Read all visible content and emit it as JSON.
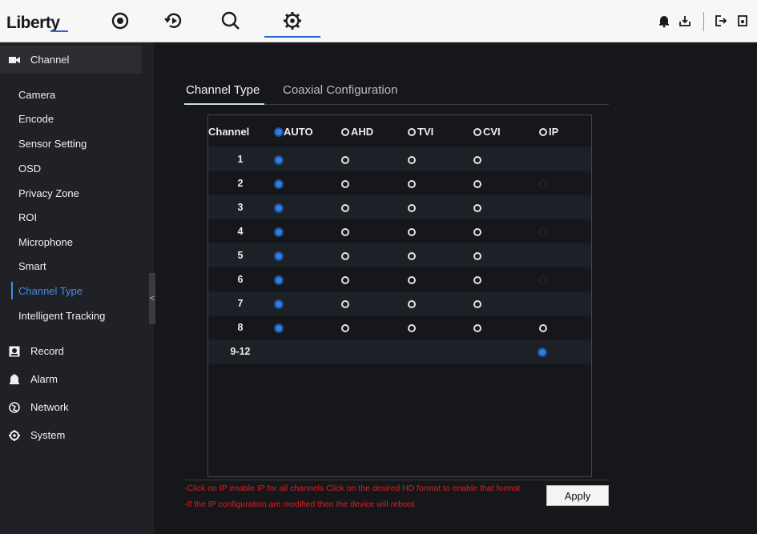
{
  "header": {
    "logo": "Liberty",
    "nav": [
      "live-view",
      "playback",
      "search",
      "settings"
    ]
  },
  "sidebar": {
    "groups": [
      {
        "label": "Channel",
        "icon": "camera-icon"
      },
      {
        "label": "Record",
        "icon": "record-icon"
      },
      {
        "label": "Alarm",
        "icon": "alarm-icon"
      },
      {
        "label": "Network",
        "icon": "network-icon"
      },
      {
        "label": "System",
        "icon": "system-icon"
      }
    ],
    "channel_items": [
      "Camera",
      "Encode",
      "Sensor Setting",
      "OSD",
      "Privacy Zone",
      "ROI",
      "Microphone",
      "Smart",
      "Channel Type",
      "Intelligent Tracking"
    ],
    "selected": "Channel Type",
    "collapse_glyph": "<"
  },
  "tabs": {
    "active": "Channel Type",
    "inactive": "Coaxial Configuration"
  },
  "table": {
    "headers": {
      "channel": "Channel",
      "auto": "AUTO",
      "ahd": "AHD",
      "tvi": "TVI",
      "cvi": "CVI",
      "ip": "IP"
    },
    "rows": [
      {
        "channel": "1",
        "mode": "AUTO",
        "ip_enabled": false
      },
      {
        "channel": "2",
        "mode": "AUTO",
        "ip_enabled": false
      },
      {
        "channel": "3",
        "mode": "AUTO",
        "ip_enabled": false
      },
      {
        "channel": "4",
        "mode": "AUTO",
        "ip_enabled": false
      },
      {
        "channel": "5",
        "mode": "AUTO",
        "ip_enabled": false
      },
      {
        "channel": "6",
        "mode": "AUTO",
        "ip_enabled": false
      },
      {
        "channel": "7",
        "mode": "AUTO",
        "ip_enabled": false
      },
      {
        "channel": "8",
        "mode": "AUTO",
        "ip_enabled": true
      }
    ],
    "extra_row": {
      "channel": "9-12",
      "mode": "IP"
    }
  },
  "notes": {
    "line1": "-Click on IP enable IP for all channels Click on the desired HD format to enable that format",
    "line2": "-If the IP configuration are modified then the device will reboot"
  },
  "apply_label": "Apply",
  "colors": {
    "accent": "#2f7fe2",
    "warning": "#d8201f",
    "background": "#16171b",
    "sidebar": "#202126"
  }
}
